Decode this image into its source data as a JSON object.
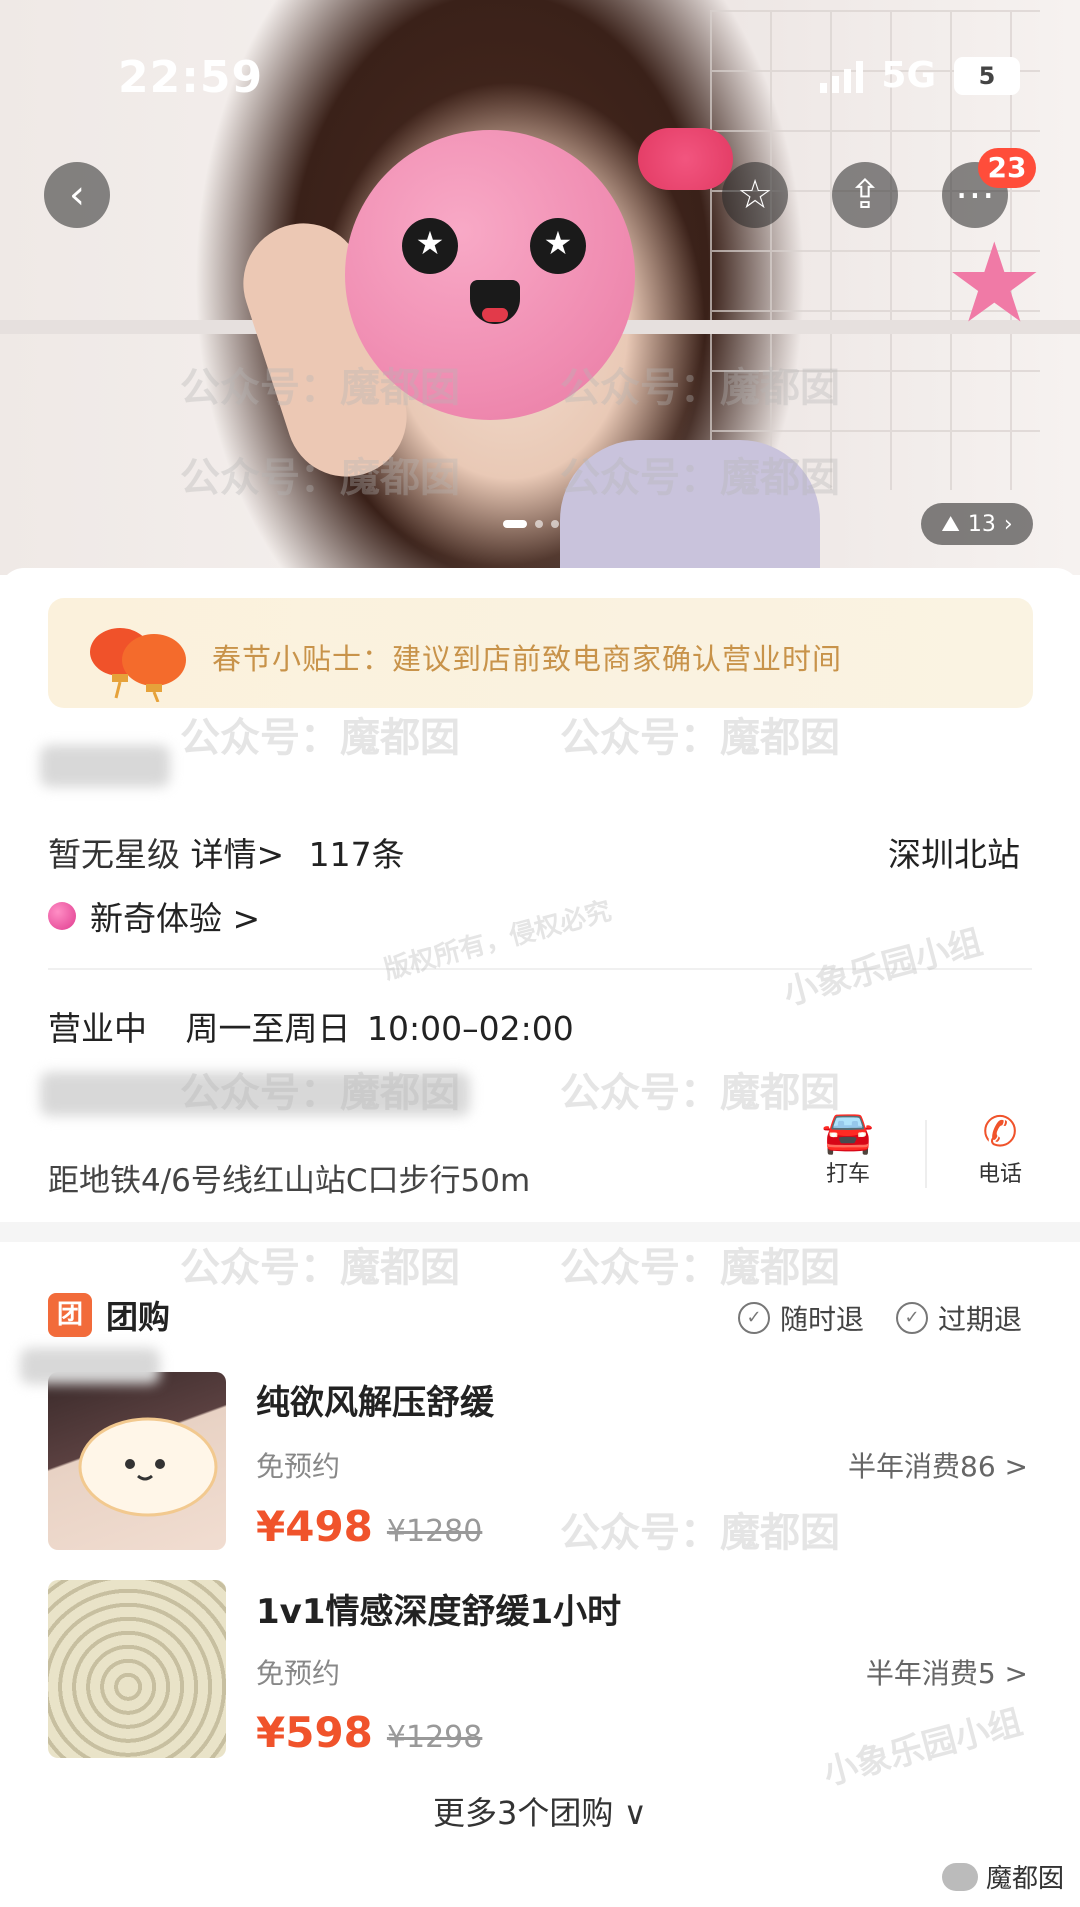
{
  "status": {
    "time": "22:59",
    "network": "5G",
    "battery": "5"
  },
  "header": {
    "badge_count": "23",
    "image_counter": "13"
  },
  "tip": {
    "text": "春节小贴士：建议到店前致电商家确认营业时间"
  },
  "shop": {
    "rating": "暂无星级",
    "details_link": "详情>",
    "reviews": "117条",
    "location": "深圳北站",
    "tag": "新奇体验 >",
    "hours_status": "营业中",
    "hours": "周一至周日 10:00–02:00",
    "subway": "距地铁4/6号线红山站C口步行50m"
  },
  "actions": {
    "taxi": "打车",
    "phone": "电话"
  },
  "group": {
    "title": "团购",
    "refund_anytime": "随时退",
    "refund_expired": "过期退",
    "deals": [
      {
        "title": "纯欲风解压舒缓",
        "note": "免预约",
        "sales": "半年消费86 >",
        "price": "¥498",
        "original": "¥1280"
      },
      {
        "title": "1v1情感深度舒缓1小时",
        "note": "免预约",
        "sales": "半年消费5 >",
        "price": "¥598",
        "original": "¥1298"
      }
    ],
    "more": "更多3个团购 ∨"
  },
  "watermarks": {
    "account": "公众号：魔都囡",
    "rights": "版权所有，侵权必究",
    "group": "小象乐园小组",
    "footer": "魔都囡"
  }
}
